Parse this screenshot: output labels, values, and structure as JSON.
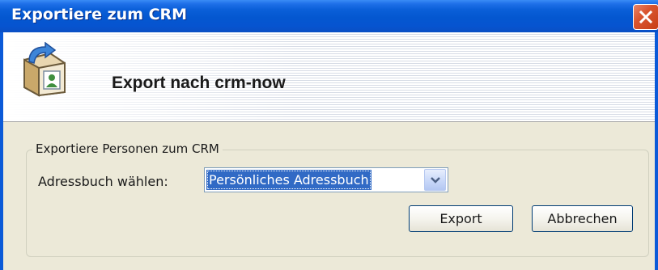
{
  "window": {
    "title": "Exportiere zum CRM",
    "close_icon": "close-icon"
  },
  "banner": {
    "title": "Export nach crm-now",
    "icon": "address-book-export-icon"
  },
  "group": {
    "legend": "Exportiere Personen zum CRM",
    "address_book_label": "Adressbuch wählen:",
    "address_book_selected": "Persönliches Adressbuch"
  },
  "buttons": {
    "export_label": "Export",
    "cancel_label": "Abbrechen"
  },
  "colors": {
    "titlebar": "#0457d0",
    "dialog_bg": "#ece9d8",
    "selection": "#316ac5",
    "close_button": "#d9552f"
  }
}
